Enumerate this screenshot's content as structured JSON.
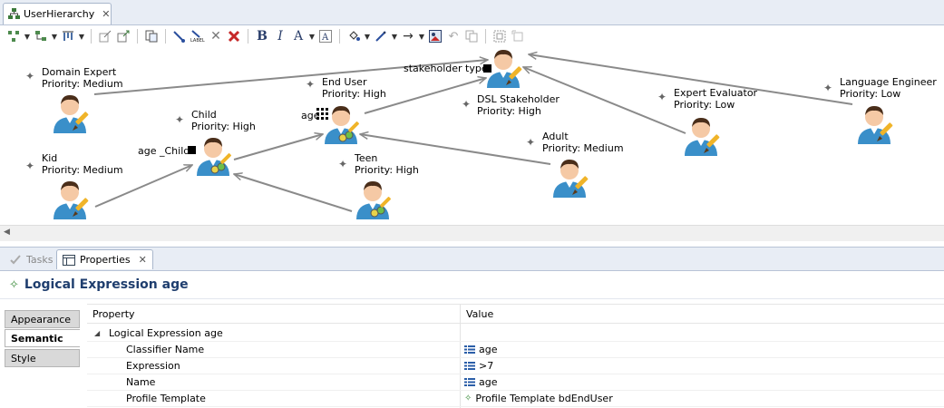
{
  "editor": {
    "tab_title": "UserHierarchy"
  },
  "toolbar": {
    "buttons": [
      "select-icon",
      "layout-icon",
      "align-icon",
      "format-icon",
      "arrange-icon",
      "copy-format-icon",
      "delete-icon",
      "bold-icon",
      "italic-icon",
      "font-color-icon",
      "text-style-icon",
      "fill-color-icon",
      "line-color-icon",
      "line-style-icon",
      "image-icon",
      "undo-icon",
      "zoom-icon"
    ],
    "bold_label": "B",
    "italic_label": "I",
    "font_label": "A"
  },
  "diagram": {
    "nodes": [
      {
        "name": "Domain Expert",
        "priority": "Priority: Medium"
      },
      {
        "name": "Kid",
        "priority": "Priority: Medium"
      },
      {
        "name": "Child",
        "priority": "Priority: High"
      },
      {
        "name": "End User",
        "priority": "Priority: High"
      },
      {
        "name": "Teen",
        "priority": "Priority: High"
      },
      {
        "name": "DSL Stakeholder",
        "priority": "Priority: High"
      },
      {
        "name": "Adult",
        "priority": "Priority: Medium"
      },
      {
        "name": "Expert Evaluator",
        "priority": "Priority: Low"
      },
      {
        "name": "Language Engineer",
        "priority": "Priority: Low"
      }
    ],
    "ports": {
      "stakeholder_type": "stakeholder type",
      "age": "age",
      "age_child": "age _Child"
    }
  },
  "views": {
    "tasks_label": "Tasks",
    "properties_label": "Properties"
  },
  "properties": {
    "title": "Logical Expression age",
    "side_tabs": [
      "Appearance",
      "Semantic",
      "Style"
    ],
    "active_tab": "Semantic",
    "columns": {
      "property": "Property",
      "value": "Value"
    },
    "group_label": "Logical Expression age",
    "rows": [
      {
        "property": "Classifier Name",
        "value": "age"
      },
      {
        "property": "Expression",
        "value": ">7"
      },
      {
        "property": "Name",
        "value": "age"
      },
      {
        "property": "Profile Template",
        "value": "Profile Template bdEndUser"
      }
    ]
  },
  "colors": {
    "accent": "#1f3e6e",
    "person_shirt": "#3a8fc9",
    "pencil": "#f0b429"
  }
}
